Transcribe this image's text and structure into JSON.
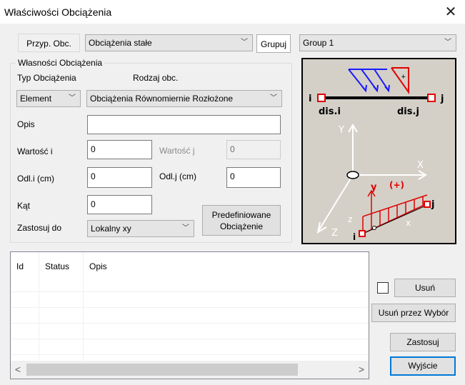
{
  "window": {
    "title": "Właściwości Obciążenia",
    "close_label": "✕"
  },
  "top_row": {
    "przyp_label": "Przyp. Obc.",
    "load_case_value": "Obciążenia stałe",
    "grupuj_label": "Grupuj",
    "group_value": "Group 1"
  },
  "group": {
    "legend": "Własności Obciążenia",
    "typ_label": "Typ Obciążenia",
    "rodzaj_label": "Rodzaj obc.",
    "element_value": "Element",
    "rodzaj_value": "Obciążenia Równomiernie Rozłożone",
    "opis_label": "Opis",
    "opis_value": "",
    "wartosc_i_label": "Wartość i",
    "wartosc_i_value": "0",
    "wartosc_j_label": "Wartość j",
    "wartosc_j_value": "0",
    "odl_i_label": "Odl.i (cm)",
    "odl_i_value": "0",
    "odl_j_label": "Odl.j (cm)",
    "odl_j_value": "0",
    "kat_label": "Kąt",
    "kat_value": "0",
    "zastosuj_do_label": "Zastosuj do",
    "zastosuj_do_value": "Lokalny xy",
    "predef_line1": "Predefiniowane",
    "predef_line2": "Obciążenie"
  },
  "diagram": {
    "i": "i",
    "j": "j",
    "dis_i": "dis.i",
    "dis_j": "dis.j",
    "Y": "Y",
    "X": "X",
    "Z": "Z",
    "y": "y",
    "plus": "(+)",
    "x": "x",
    "z": "z"
  },
  "list": {
    "columns": [
      "Id",
      "Status",
      "Opis"
    ]
  },
  "buttons": {
    "usun": "Usuń",
    "usun_przez": "Usuń przez Wybór",
    "zastosuj": "Zastosuj",
    "wyjscie": "Wyjście"
  },
  "scroll": {
    "left": "<",
    "right": ">"
  },
  "icons": {
    "close": "close-icon",
    "dropdown": "chevron-down-icon"
  },
  "colors": {
    "accent": "#0078d7",
    "diagram_bg": "#d4d0c8",
    "load_red": "#e00000",
    "arrow_blue": "#1a1aff"
  }
}
